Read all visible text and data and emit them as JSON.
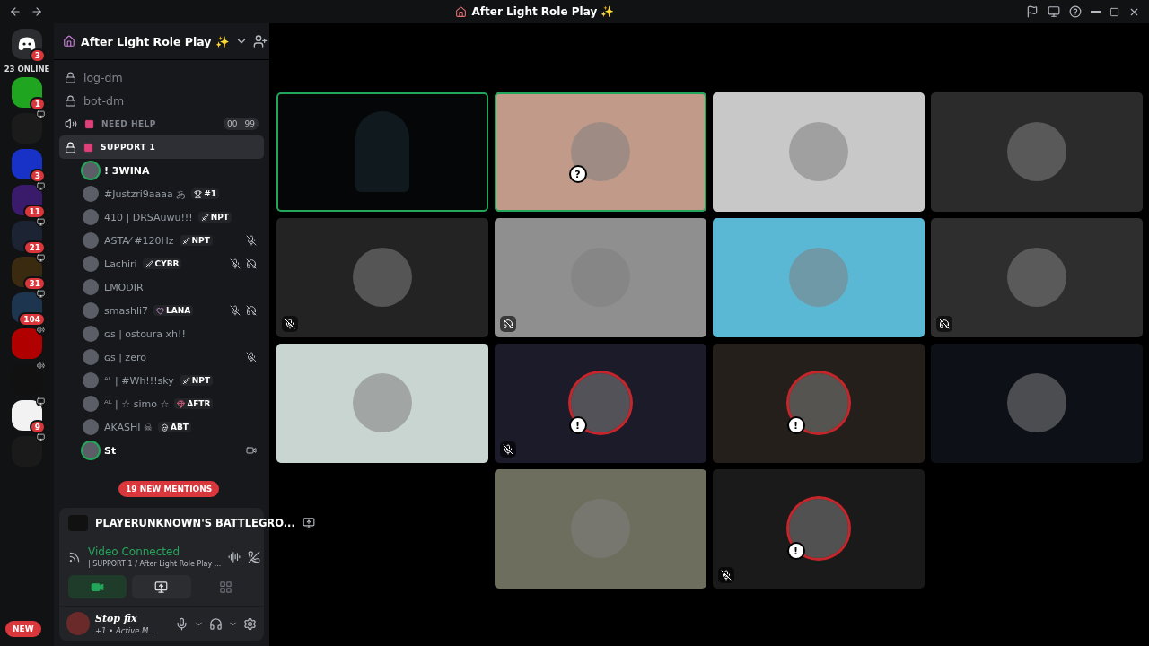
{
  "window": {
    "title": "After Light Role Play ✨"
  },
  "rail": {
    "home_badge": "3",
    "online": "23 ONLINE",
    "new_pill": "NEW",
    "servers": [
      {
        "color": "#1fa51f",
        "badge": "1"
      },
      {
        "color": "#1b1b1b",
        "kind": "screen"
      },
      {
        "color": "#1832c8",
        "badge": "3"
      },
      {
        "color": "#3a1a6a",
        "badge": "11",
        "kind": "screen"
      },
      {
        "color": "#1c2433",
        "badge": "21",
        "kind": "screen"
      },
      {
        "color": "#3a2a10",
        "badge": "31",
        "kind": "screen"
      },
      {
        "color": "#1e3550",
        "badge": "104",
        "kind": "screen"
      },
      {
        "color": "#b00000",
        "kind": "speaker"
      },
      {
        "color": "#111111",
        "kind": "speaker"
      },
      {
        "color": "#f2f2f2",
        "badge": "9",
        "kind": "screen"
      },
      {
        "color": "#1a1a1a",
        "kind": "screen"
      }
    ]
  },
  "server": {
    "name": "After Light Role Play ✨"
  },
  "channels": [
    {
      "kind": "text",
      "name": "log-dm",
      "selected": false
    },
    {
      "kind": "text",
      "name": "bot-dm",
      "selected": false
    },
    {
      "kind": "voice",
      "name": "NEED HELP",
      "counter": [
        "00",
        "99"
      ],
      "selected": false
    },
    {
      "kind": "voice-locked",
      "name": "SUPPORT 1",
      "selected": true
    }
  ],
  "members": [
    {
      "name": "! 3WINA",
      "speaking": true,
      "muted": false,
      "deafened": false,
      "video": false
    },
    {
      "name": "#Justzri9aaaa あ",
      "tag": {
        "kind": "trophy",
        "text": "#1"
      },
      "speaking": false,
      "muted": false,
      "deafened": false,
      "video": false
    },
    {
      "name": "410 | DRSAuwu!!!",
      "tag": {
        "kind": "sword",
        "text": "NPT"
      },
      "speaking": false,
      "muted": false,
      "deafened": false,
      "video": false
    },
    {
      "name": "ASTA⁄ #120Hz",
      "tag": {
        "kind": "sword",
        "text": "NPT"
      },
      "speaking": false,
      "muted": true,
      "deafened": false,
      "video": false
    },
    {
      "name": "Lachiri",
      "tag": {
        "kind": "sword",
        "text": "CYBR"
      },
      "speaking": false,
      "muted": true,
      "deafened": true,
      "video": false
    },
    {
      "name": "LMODIR",
      "speaking": false,
      "muted": false,
      "deafened": false,
      "video": false
    },
    {
      "name": "smashli7",
      "tag": {
        "kind": "heart",
        "text": "LANA"
      },
      "speaking": false,
      "muted": true,
      "deafened": true,
      "video": false
    },
    {
      "name": "ɢꜱ |  ostoura xh!!",
      "speaking": false,
      "muted": false,
      "deafened": false,
      "video": false
    },
    {
      "name": "ɢꜱ |  zero",
      "speaking": false,
      "muted": true,
      "deafened": false,
      "video": false
    },
    {
      "name": "ᴬᴸ | #Wh!!!sky",
      "tag": {
        "kind": "sword",
        "text": "NPT"
      },
      "speaking": false,
      "muted": false,
      "deafened": false,
      "video": false
    },
    {
      "name": "ᴬᴸ | ☆ simo ☆",
      "tag": {
        "kind": "gem",
        "text": "AFTR"
      },
      "speaking": false,
      "muted": false,
      "deafened": false,
      "video": false
    },
    {
      "name": "AKASHI ☠",
      "tag": {
        "kind": "skull",
        "text": "ABT"
      },
      "speaking": false,
      "muted": false,
      "deafened": false,
      "video": false
    },
    {
      "name": "St",
      "speaking": true,
      "muted": false,
      "deafened": false,
      "video": true
    }
  ],
  "mentions_pill": "19 NEW MENTIONS",
  "activity": {
    "game": "PLAYERUNKNOWN'S BATTLEGRO..."
  },
  "voice": {
    "status": "Video Connected",
    "path": "| SUPPORT 1 / After Light Role Play ...",
    "camera_on": true
  },
  "user": {
    "name": "Stop fix",
    "status": "+1 • Active M..."
  },
  "tiles": [
    {
      "kind": "video",
      "color": "#050607",
      "speaking": true,
      "muted": false,
      "deafened": false
    },
    {
      "kind": "avatar",
      "color": "#c29a8a",
      "speaking": true,
      "muted": false,
      "deafened": false,
      "alert": false,
      "badge": "?"
    },
    {
      "kind": "avatar",
      "color": "#c8c8c8",
      "speaking": false,
      "muted": false,
      "deafened": false,
      "alert": false
    },
    {
      "kind": "avatar",
      "color": "#2b2b2b",
      "speaking": false,
      "muted": false,
      "deafened": false,
      "alert": false
    },
    {
      "kind": "avatar",
      "color": "#232323",
      "speaking": false,
      "muted": true,
      "deafened": false,
      "alert": false
    },
    {
      "kind": "avatar",
      "color": "#8f8f8f",
      "speaking": false,
      "muted": false,
      "deafened": true,
      "alert": false
    },
    {
      "kind": "avatar",
      "color": "#5bb8d4",
      "speaking": false,
      "muted": false,
      "deafened": false,
      "alert": false
    },
    {
      "kind": "avatar",
      "color": "#2e2e2e",
      "speaking": false,
      "muted": false,
      "deafened": true,
      "alert": false
    },
    {
      "kind": "avatar",
      "color": "#c9d5d0",
      "speaking": false,
      "muted": false,
      "deafened": false,
      "alert": false
    },
    {
      "kind": "avatar",
      "color": "#1c1b29",
      "speaking": false,
      "muted": true,
      "deafened": false,
      "alert": true,
      "badge": "!"
    },
    {
      "kind": "avatar",
      "color": "#241f1a",
      "speaking": false,
      "muted": false,
      "deafened": false,
      "alert": true,
      "badge": "!"
    },
    {
      "kind": "avatar",
      "color": "#0d1117",
      "speaking": false,
      "muted": false,
      "deafened": false,
      "alert": false
    },
    {
      "kind": "avatar",
      "color": "#6e6e5e",
      "speaking": false,
      "muted": false,
      "deafened": false,
      "alert": false
    },
    {
      "kind": "avatar",
      "color": "#1a1a1a",
      "speaking": false,
      "muted": true,
      "deafened": false,
      "alert": true,
      "badge": "!"
    }
  ]
}
